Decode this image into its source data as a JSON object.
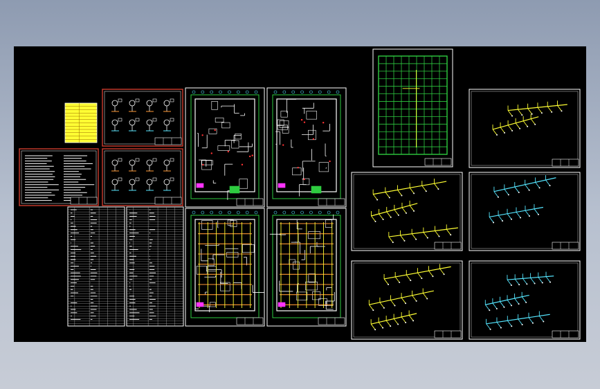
{
  "viewport": {
    "background": "#000000",
    "line_colors": {
      "frame": "#ffffff",
      "red_frame": "#c0392b",
      "grid_green": "#2ecc40",
      "yellow": "#ffff33",
      "cyan": "#55e6ff",
      "magenta": "#ff33ff",
      "orange": "#ff9933"
    }
  },
  "sheets": [
    {
      "id": "cover-yellow-table",
      "kind": "table-yellow"
    },
    {
      "id": "notes-sheet",
      "kind": "notes"
    },
    {
      "id": "details-sheet-1",
      "kind": "details"
    },
    {
      "id": "details-sheet-2",
      "kind": "details"
    },
    {
      "id": "equipment-table-1",
      "kind": "table-white"
    },
    {
      "id": "equipment-table-2",
      "kind": "table-white"
    },
    {
      "id": "floor-plan-1",
      "kind": "plan"
    },
    {
      "id": "floor-plan-2",
      "kind": "plan"
    },
    {
      "id": "piping-plan-1",
      "kind": "plan-piping"
    },
    {
      "id": "piping-plan-2",
      "kind": "plan-piping"
    },
    {
      "id": "grid-roof-plan",
      "kind": "grid"
    },
    {
      "id": "isometric-yellow-1",
      "kind": "iso-yellow"
    },
    {
      "id": "isometric-yellow-2",
      "kind": "iso-yellow"
    },
    {
      "id": "isometric-yellow-3",
      "kind": "iso-yellow"
    },
    {
      "id": "isometric-cyan-1",
      "kind": "iso-cyan"
    },
    {
      "id": "isometric-cyan-2",
      "kind": "iso-cyan"
    }
  ]
}
